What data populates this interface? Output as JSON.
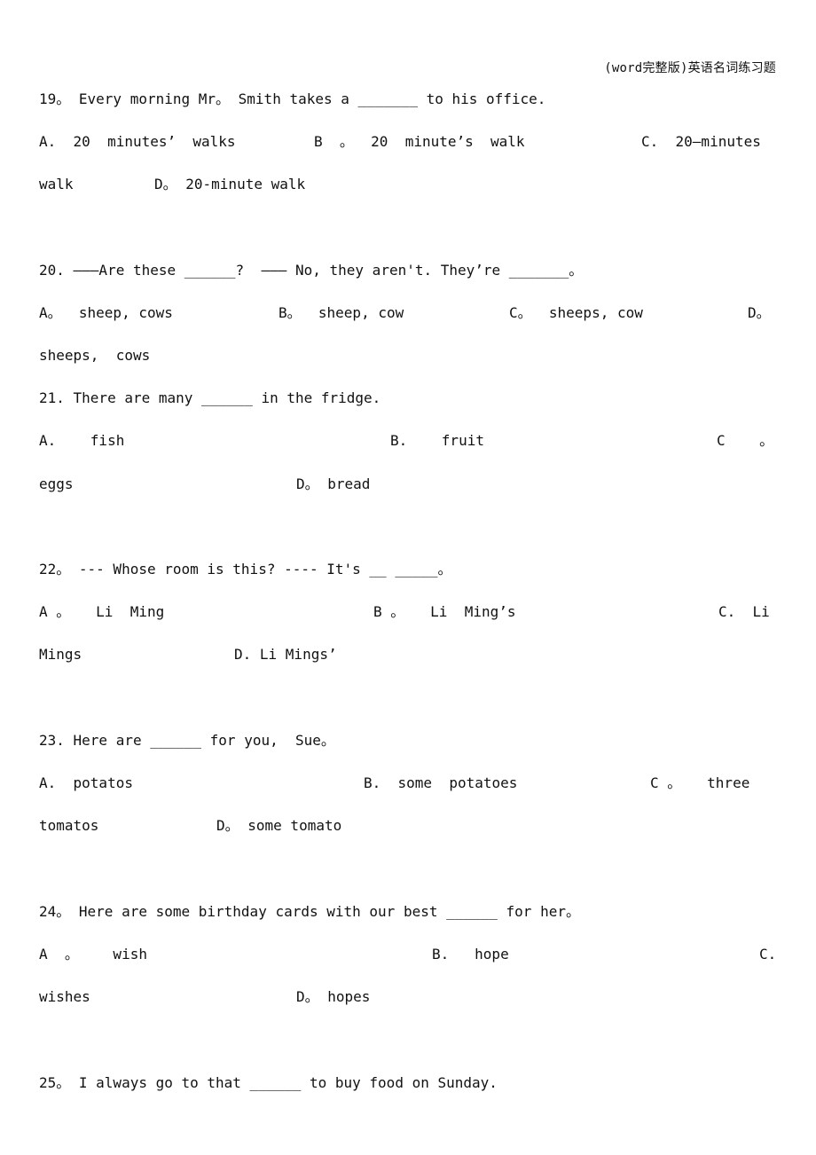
{
  "header": {
    "title": "(word完整版)英语名词练习题"
  },
  "questions": [
    {
      "number": "19",
      "stem": "19。 Every morning Mr。 Smith takes a _______ to his office.",
      "options": {
        "A": "A.  20  minutes’  walks",
        "B": "B  。  20  minute’s  walk",
        "C": "C.  20—minutes",
        "C_cont": "walk",
        "D": "D。 20-minute walk"
      }
    },
    {
      "number": "20",
      "stem": "20. ———Are these ______?  ——— No, they aren't. They’re _______。",
      "options": {
        "A": "A。  sheep, cows",
        "B": "B。  sheep, cow",
        "C": "C。  sheeps, cow",
        "D": "D。",
        "D_cont": "sheeps,  cows"
      }
    },
    {
      "number": "21",
      "stem": "21. There are many ______ in the fridge.",
      "options": {
        "A": "A.    fish",
        "B": "B.    fruit",
        "C": "C    。",
        "C_cont": "eggs",
        "D": "D。 bread"
      }
    },
    {
      "number": "22",
      "stem": "22。 --- Whose room is this? ---- It's __ _____。",
      "options": {
        "A": "A 。   Li  Ming",
        "B": "B 。   Li  Ming’s",
        "C": "C.  Li",
        "C_cont": "Mings",
        "D": "D. Li Mings’"
      }
    },
    {
      "number": "23",
      "stem": "23. Here are ______ for you,  Sue。",
      "options": {
        "A": "A.  potatos",
        "B": "B.  some  potatoes",
        "C": "C 。   three",
        "C_cont": "tomatos",
        "D": "D。 some tomato"
      }
    },
    {
      "number": "24",
      "stem": "24。 Here are some birthday cards with our best ______ for her。",
      "options": {
        "A": "A  。    wish",
        "B": "B.   hope",
        "C": "C.",
        "C_cont": "wishes",
        "D": "D。 hopes"
      }
    },
    {
      "number": "25",
      "stem": "25。 I always go to that ______ to buy food on Sunday."
    }
  ]
}
